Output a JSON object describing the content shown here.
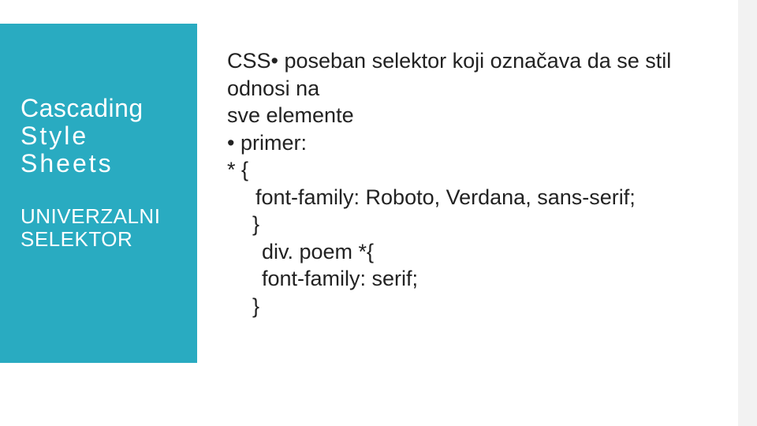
{
  "left": {
    "title_line1": "Cascading",
    "title_line2": "Style Sheets",
    "subtitle": "UNIVERZALNI SELEKTOR"
  },
  "content": {
    "l1": "CSS• poseban selektor koji označava da se stil",
    "l2": "odnosi na",
    "l3": "sve elemente",
    "l4": "• primer:",
    "l5": "* {",
    "l6": "font-family: Roboto, Verdana, sans-serif;",
    "l7": "}",
    "l8": "div. poem *{",
    "l9": "font-family: serif;",
    "l10": "}"
  }
}
